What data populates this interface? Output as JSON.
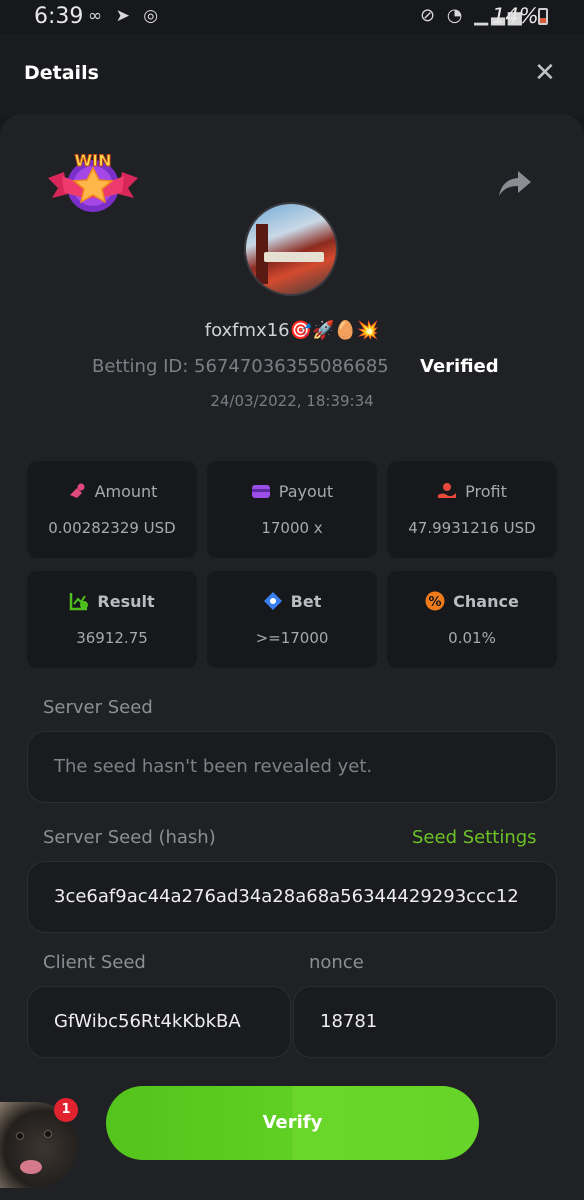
{
  "status_bar": {
    "time": "6:39",
    "left_icons": "∞ ➤ ◎",
    "right_icons": "⊘ ◔ ▁▃▅",
    "battery": "14%"
  },
  "header": {
    "title": "Details",
    "close_icon": "close-icon"
  },
  "bet": {
    "badge_text": "WIN",
    "username": "foxfmx16🎯🚀🥚💥",
    "betting_id": "Betting ID: 56747036355086685",
    "verified": "Verified",
    "date": "24/03/2022, 18:39:34"
  },
  "stats": [
    {
      "label": "Amount",
      "value": "0.00282329 USD",
      "icon": "amount-icon",
      "color": "#e0497a"
    },
    {
      "label": "Payout",
      "value": "17000 x",
      "icon": "payout-card-icon",
      "color": "#9b4fe8"
    },
    {
      "label": "Profit",
      "value": "47.9931216 USD",
      "icon": "profit-hand-icon",
      "color": "#e8493a"
    },
    {
      "label": "Result",
      "value": "36912.75",
      "icon": "result-chart-icon",
      "color": "#4fbf1e"
    },
    {
      "label": "Bet",
      "value": ">=17000",
      "icon": "bet-diamond-icon",
      "color": "#3a7ef0"
    },
    {
      "label": "Chance",
      "value": "0.01%",
      "icon": "chance-percent-icon",
      "color": "#f07b1a"
    }
  ],
  "server_seed": {
    "label": "Server Seed",
    "value": "The seed hasn't been revealed yet."
  },
  "server_seed_hash": {
    "label": "Server Seed (hash)",
    "settings_link": "Seed Settings",
    "value": "3ce6af9ac44a276ad34a28a68a56344429293ccc12"
  },
  "client_seed": {
    "label": "Client Seed",
    "value": "GfWibc56Rt4kKbkBA"
  },
  "nonce": {
    "label": "nonce",
    "value": "18781"
  },
  "verify_button": "Verify",
  "chat": {
    "badge_count": "1"
  },
  "colors": {
    "accent_green": "#6bc326",
    "background": "#17181b",
    "panel": "#202124"
  }
}
